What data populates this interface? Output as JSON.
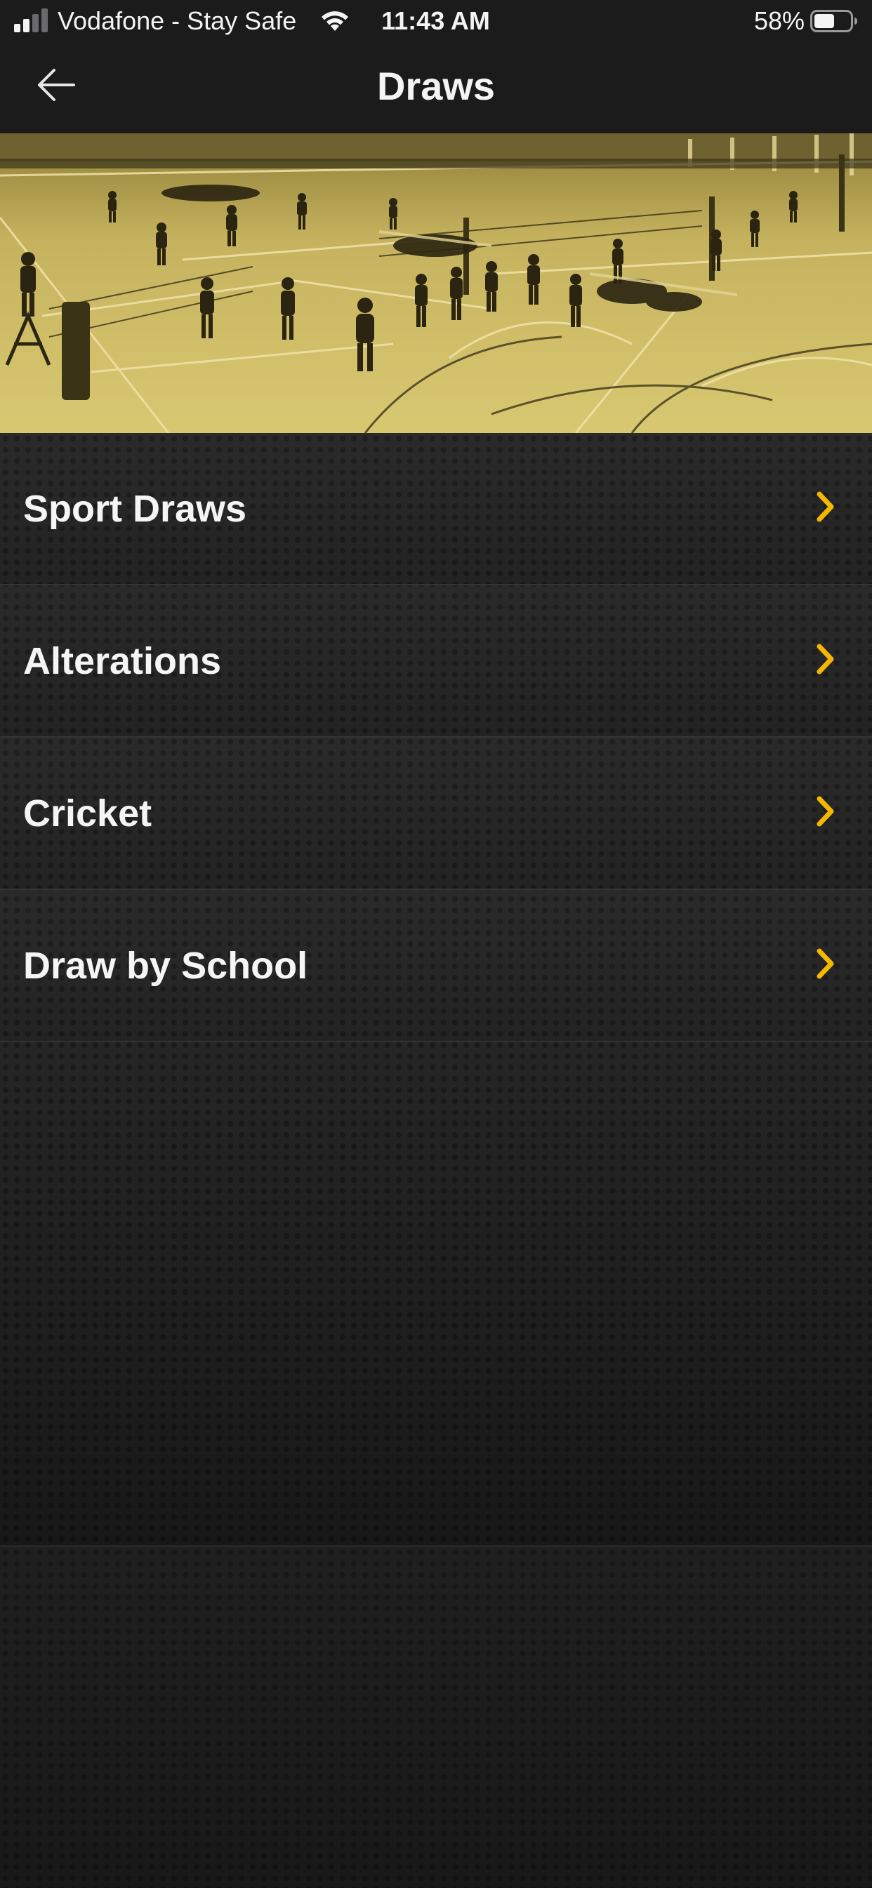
{
  "status_bar": {
    "carrier": "Vodafone - Stay Safe",
    "time": "11:43 AM",
    "battery_percent": "58%",
    "battery_level": 0.58,
    "signal_icon": "cellular-signal-icon",
    "wifi_icon": "wifi-icon",
    "battery_icon": "battery-icon"
  },
  "nav": {
    "title": "Draws",
    "back_icon": "back-arrow-icon"
  },
  "hero": {
    "description_icon": "volleyball-hall-photo"
  },
  "menu": {
    "items": [
      {
        "label": "Sport Draws"
      },
      {
        "label": "Alterations"
      },
      {
        "label": "Cricket"
      },
      {
        "label": "Draw by School"
      }
    ],
    "chevron_icon": "chevron-right-icon"
  },
  "colors": {
    "accent": "#f5b800",
    "background": "#1c1c1d",
    "hero_tint": "#c9b865"
  }
}
